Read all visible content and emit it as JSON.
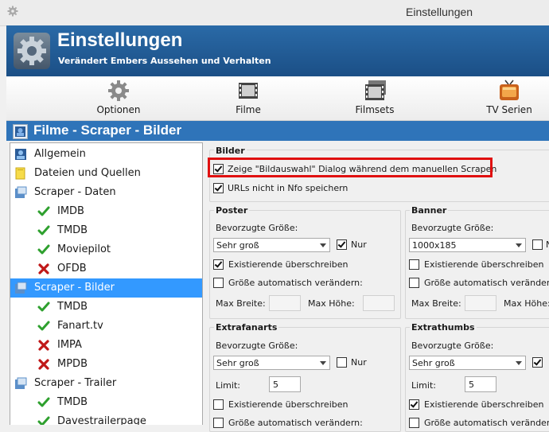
{
  "window": {
    "title": "Einstellungen"
  },
  "header": {
    "title": "Einstellungen",
    "subtitle": "Verändert Embers Aussehen und Verhalten"
  },
  "toolbar": {
    "items": [
      {
        "label": "Optionen",
        "icon": "gear-icon"
      },
      {
        "label": "Filme",
        "icon": "film-icon"
      },
      {
        "label": "Filmsets",
        "icon": "filmset-icon"
      },
      {
        "label": "TV Serien",
        "icon": "tv-icon"
      }
    ]
  },
  "section": {
    "title": "Filme - Scraper - Bilder"
  },
  "tree": {
    "items": [
      {
        "label": "Allgemein",
        "icon": "general-icon",
        "level": 0
      },
      {
        "label": "Dateien und Quellen",
        "icon": "folder-icon",
        "level": 0
      },
      {
        "label": "Scraper - Daten",
        "icon": "scraper-icon",
        "level": 0
      },
      {
        "label": "IMDB",
        "icon": "check-icon",
        "level": 1
      },
      {
        "label": "TMDB",
        "icon": "check-icon",
        "level": 1
      },
      {
        "label": "Moviepilot",
        "icon": "check-icon",
        "level": 1
      },
      {
        "label": "OFDB",
        "icon": "cross-icon",
        "level": 1
      },
      {
        "label": "Scraper - Bilder",
        "icon": "scraper-icon",
        "level": 0,
        "selected": true
      },
      {
        "label": "TMDB",
        "icon": "check-icon",
        "level": 1
      },
      {
        "label": "Fanart.tv",
        "icon": "check-icon",
        "level": 1
      },
      {
        "label": "IMPA",
        "icon": "cross-icon",
        "level": 1
      },
      {
        "label": "MPDB",
        "icon": "cross-icon",
        "level": 1
      },
      {
        "label": "Scraper - Trailer",
        "icon": "scraper-icon",
        "level": 0
      },
      {
        "label": "TMDB",
        "icon": "check-icon",
        "level": 1
      },
      {
        "label": "Davestrailerpage",
        "icon": "check-icon",
        "level": 1
      }
    ]
  },
  "bilder": {
    "title": "Bilder",
    "opt_dialog": "Zeige \"Bildauswahl\" Dialog während dem manuellen Scrapen",
    "opt_dialog_checked": true,
    "opt_urls": "URLs nicht in Nfo speichern",
    "opt_urls_checked": true
  },
  "poster": {
    "title": "Poster",
    "pref_label": "Bevorzugte Größe:",
    "pref_value": "Sehr groß",
    "only_label": "Nur",
    "only_checked": true,
    "overwrite_label": "Existierende überschreiben",
    "overwrite_checked": true,
    "resize_label": "Größe automatisch verändern:",
    "resize_checked": false,
    "maxw_label": "Max Breite:",
    "maxh_label": "Max Höhe:"
  },
  "banner": {
    "title": "Banner",
    "pref_label": "Bevorzugte Größe:",
    "pref_value": "1000x185",
    "only_label": "N",
    "only_checked": false,
    "overwrite_label": "Existierende überschreiben",
    "overwrite_checked": false,
    "resize_label": "Größe automatisch verändern:",
    "resize_checked": false,
    "maxw_label": "Max Breite:",
    "maxh_label": "Max Höhe:"
  },
  "extrafanarts": {
    "title": "Extrafanarts",
    "pref_label": "Bevorzugte Größe:",
    "pref_value": "Sehr groß",
    "only_label": "Nur",
    "only_checked": false,
    "limit_label": "Limit:",
    "limit_value": "5",
    "overwrite_label": "Existierende überschreiben",
    "overwrite_checked": false,
    "resize_label": "Größe automatisch verändern:",
    "resize_checked": false
  },
  "extrathumbs": {
    "title": "Extrathumbs",
    "pref_label": "Bevorzugte Größe:",
    "pref_value": "Sehr groß",
    "only_checked": true,
    "limit_label": "Limit:",
    "limit_value": "5",
    "overwrite_label": "Existierende überschreiben",
    "overwrite_checked": true,
    "resize_label": "Größe automatisch verändern:",
    "resize_checked": false
  },
  "colors": {
    "accent": "#2f74b9",
    "selection": "#3399ff",
    "highlight": "#e01010",
    "check": "#2ea02e",
    "cross": "#c01818"
  }
}
